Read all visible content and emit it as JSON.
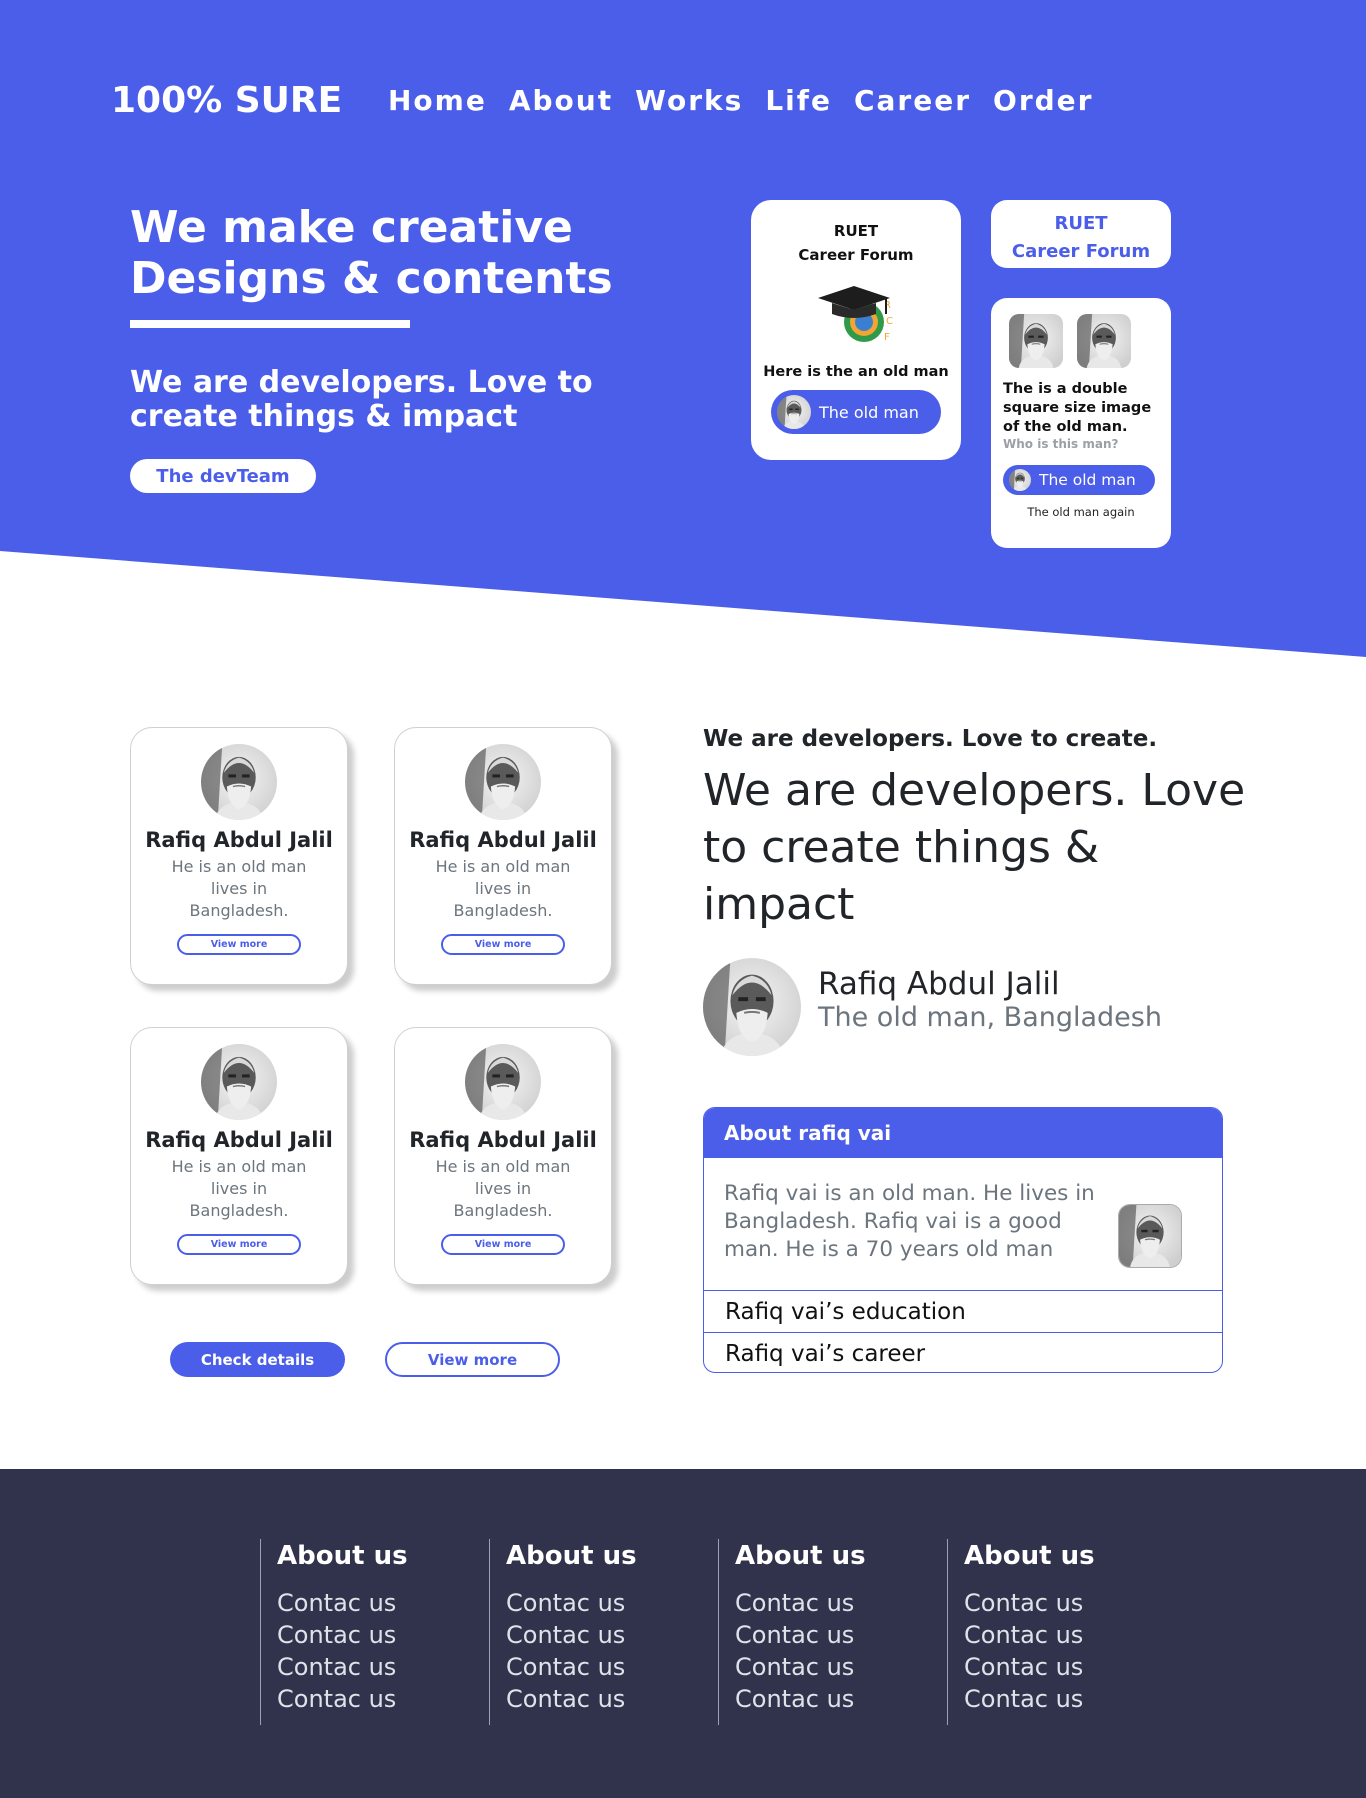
{
  "brand": {
    "logo": "100% SURE",
    "accent": "#4b5eea",
    "footer_bg": "#30334b"
  },
  "nav": [
    "Home",
    "About",
    "Works",
    "Life",
    "Career",
    "Order"
  ],
  "hero": {
    "title_line1": "We make creative",
    "title_line2": "Designs & contents",
    "subtitle": "We are developers. Love to create things & impact",
    "cta": "The devTeam"
  },
  "forum_card": {
    "line1": "RUET",
    "line2": "Career Forum",
    "caption": "Here is the an old man",
    "pill": "The old man"
  },
  "forum_tag": {
    "line1": "RUET",
    "line2": "Career Forum"
  },
  "double_card": {
    "desc": "The is a double square size image of the old man.",
    "question": "Who is this man?",
    "pill": "The old man",
    "footer": "The old man again"
  },
  "profiles": [
    {
      "name": "Rafiq Abdul Jalil",
      "bio": "He is an old man lives in Bangladesh.",
      "button": "View more"
    },
    {
      "name": "Rafiq Abdul Jalil",
      "bio": "He is an old man lives in Bangladesh.",
      "button": "View more"
    },
    {
      "name": "Rafiq Abdul Jalil",
      "bio": "He is an old man lives in Bangladesh.",
      "button": "View more"
    },
    {
      "name": "Rafiq Abdul Jalil",
      "bio": "He is an old man lives in Bangladesh.",
      "button": "View more"
    }
  ],
  "actions": {
    "check": "Check details",
    "view": "View more"
  },
  "intro": {
    "small": "We are developers. Love to create.",
    "big": "We are developers. Love to create things & impact",
    "person_name": "Rafiq Abdul Jalil",
    "person_sub": "The old man, Bangladesh"
  },
  "accordion": {
    "header": "About rafiq vai",
    "body": "Rafiq vai is an old man. He lives in Bangladesh. Rafiq vai is a good man. He is a 70 years old man",
    "items": [
      "Rafiq vai’s education",
      "Rafiq vai’s career"
    ]
  },
  "footer": {
    "columns": [
      {
        "heading": "About us",
        "links": [
          "Contac us",
          "Contac us",
          "Contac us",
          "Contac us"
        ]
      },
      {
        "heading": "About us",
        "links": [
          "Contac us",
          "Contac us",
          "Contac us",
          "Contac us"
        ]
      },
      {
        "heading": "About us",
        "links": [
          "Contac us",
          "Contac us",
          "Contac us",
          "Contac us"
        ]
      },
      {
        "heading": "About us",
        "links": [
          "Contac us",
          "Contac us",
          "Contac us",
          "Contac us"
        ]
      }
    ]
  }
}
